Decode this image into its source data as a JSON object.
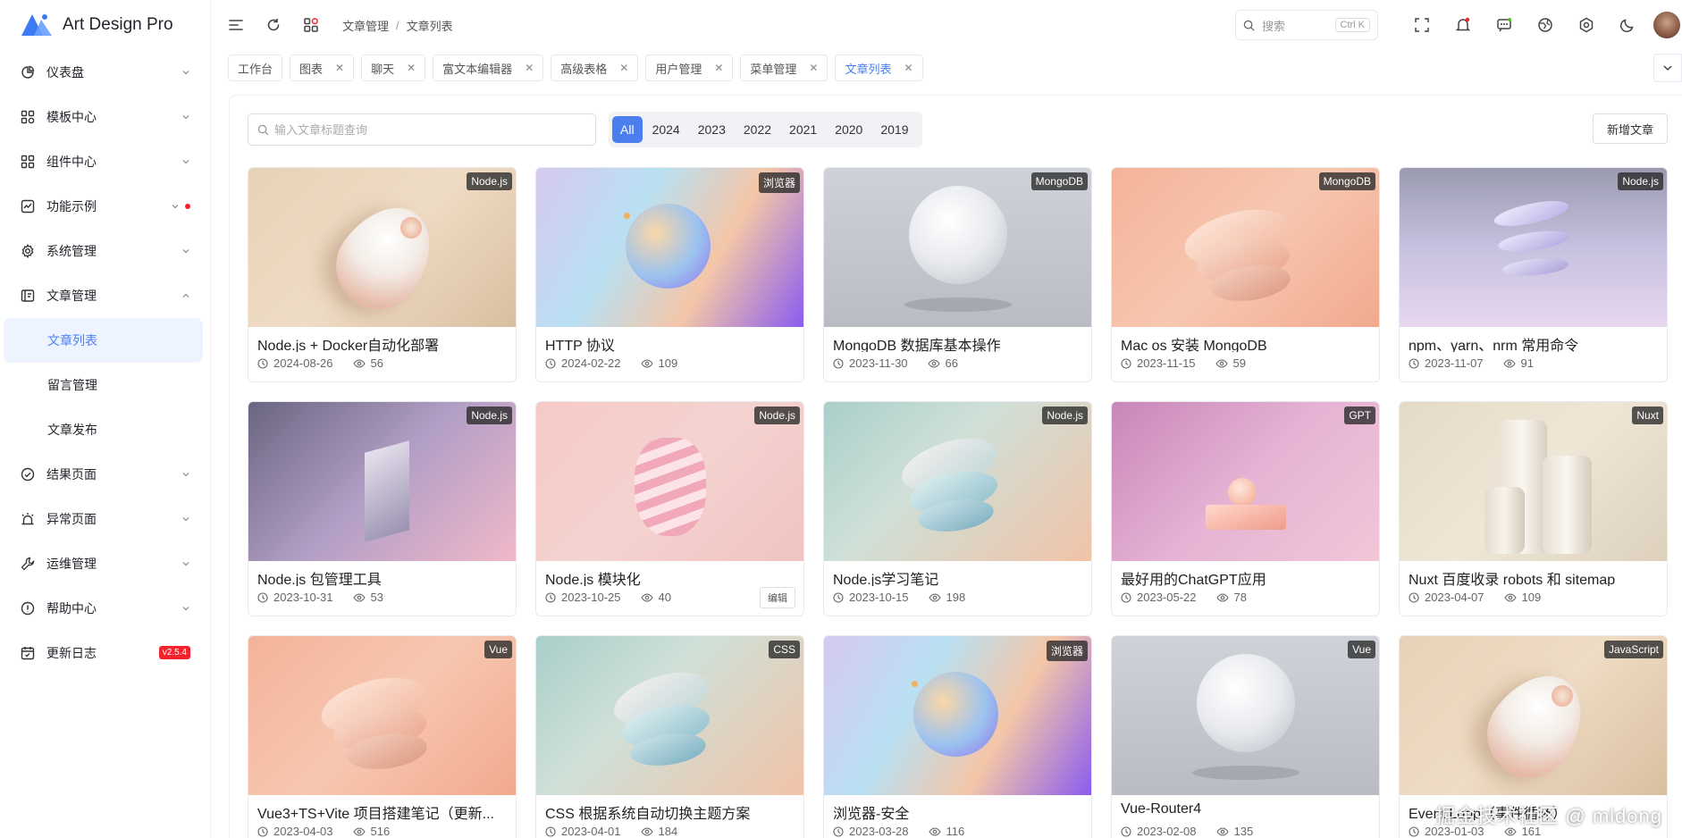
{
  "app": {
    "title": "Art Design Pro"
  },
  "sidebar": {
    "items": [
      {
        "label": "仪表盘",
        "icon": "dashboard-icon"
      },
      {
        "label": "模板中心",
        "icon": "template-icon"
      },
      {
        "label": "组件中心",
        "icon": "widget-icon"
      },
      {
        "label": "功能示例",
        "icon": "code-icon"
      },
      {
        "label": "系统管理",
        "icon": "gear-icon"
      },
      {
        "label": "文章管理",
        "icon": "article-icon"
      }
    ],
    "sub_items": [
      {
        "label": "文章列表"
      },
      {
        "label": "留言管理"
      },
      {
        "label": "文章发布"
      }
    ],
    "items_after": [
      {
        "label": "结果页面",
        "icon": "check-circle-icon"
      },
      {
        "label": "异常页面",
        "icon": "alarm-icon"
      },
      {
        "label": "运维管理",
        "icon": "wrench-icon"
      },
      {
        "label": "帮助中心",
        "icon": "info-circle-icon"
      },
      {
        "label": "更新日志",
        "icon": "calendar-icon"
      }
    ],
    "version": "v2.5.4"
  },
  "header": {
    "breadcrumb": [
      "文章管理",
      "文章列表"
    ],
    "search_label": "搜索",
    "search_shortcut": "Ctrl K"
  },
  "tabs": [
    {
      "label": "工作台"
    },
    {
      "label": "图表"
    },
    {
      "label": "聊天"
    },
    {
      "label": "富文本编辑器"
    },
    {
      "label": "高级表格"
    },
    {
      "label": "用户管理"
    },
    {
      "label": "菜单管理"
    },
    {
      "label": "文章列表"
    }
  ],
  "toolbar": {
    "search_placeholder": "输入文章标题查询",
    "years": [
      "All",
      "2024",
      "2023",
      "2022",
      "2021",
      "2020",
      "2019"
    ],
    "add_label": "新增文章"
  },
  "cards": [
    {
      "tag": "Node.js",
      "title": "Node.js + Docker自动化部署",
      "date": "2024-08-26",
      "views": "56",
      "img": "egg-beige"
    },
    {
      "tag": "浏览器",
      "title": "HTTP 协议",
      "date": "2024-02-22",
      "views": "109",
      "img": "sphere-holo"
    },
    {
      "tag": "MongoDB",
      "title": "MongoDB 数据库基本操作",
      "date": "2023-11-30",
      "views": "66",
      "img": "moon-grey"
    },
    {
      "tag": "MongoDB",
      "title": "Mac os 安装 MongoDB",
      "date": "2023-11-15",
      "views": "59",
      "img": "discs-peach"
    },
    {
      "tag": "Node.js",
      "title": "npm、yarn、nrm 常用命令",
      "date": "2023-11-07",
      "views": "91",
      "img": "discs-lavender"
    },
    {
      "tag": "Node.js",
      "title": "Node.js 包管理工具",
      "date": "2023-10-31",
      "views": "53",
      "img": "crystal-mauve"
    },
    {
      "tag": "Node.js",
      "title": "Node.js 模块化",
      "date": "2023-10-25",
      "views": "40",
      "img": "swirl-pink",
      "edit": "编辑"
    },
    {
      "tag": "Node.js",
      "title": "Node.js学习笔记",
      "date": "2023-10-15",
      "views": "198",
      "img": "discs-mint"
    },
    {
      "tag": "GPT",
      "title": "最好用的ChatGPT应用",
      "date": "2023-05-22",
      "views": "78",
      "img": "blocks-magenta"
    },
    {
      "tag": "Nuxt",
      "title": "Nuxt 百度收录 robots 和 sitemap",
      "date": "2023-04-07",
      "views": "109",
      "img": "cylinders-cream"
    },
    {
      "tag": "Vue",
      "title": "Vue3+TS+Vite 项目搭建笔记（更新...",
      "date": "2023-04-03",
      "views": "516",
      "img": "discs-peach"
    },
    {
      "tag": "CSS",
      "title": "CSS 根据系统自动切换主题方案",
      "date": "2023-04-01",
      "views": "184",
      "img": "discs-mint"
    },
    {
      "tag": "浏览器",
      "title": "浏览器-安全",
      "date": "2023-03-28",
      "views": "116",
      "img": "sphere-holo"
    },
    {
      "tag": "Vue",
      "title": "Vue-Router4",
      "date": "2023-02-08",
      "views": "135",
      "img": "moon-grey"
    },
    {
      "tag": "JavaScript",
      "title": "Event Loop（事件循环）",
      "date": "2023-01-03",
      "views": "161",
      "img": "egg-beige"
    }
  ],
  "watermark": "掘金技术社区 @ mldong",
  "colors": {
    "accent": "#4b7ff0",
    "badge": "#f5222d"
  }
}
